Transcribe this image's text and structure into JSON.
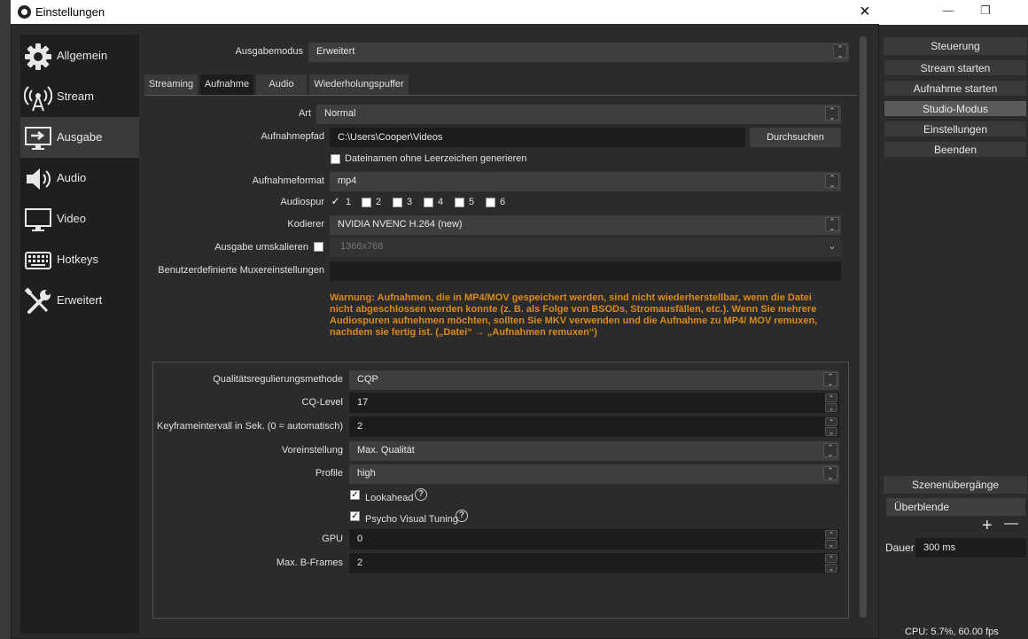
{
  "window": {
    "title": "Einstellungen",
    "close_icon": "×"
  },
  "sidebar": {
    "items": [
      {
        "label": "Allgemein",
        "icon": "gear-icon"
      },
      {
        "label": "Stream",
        "icon": "antenna-icon"
      },
      {
        "label": "Ausgabe",
        "icon": "monitor-arrow-icon",
        "active": true
      },
      {
        "label": "Audio",
        "icon": "speaker-icon"
      },
      {
        "label": "Video",
        "icon": "monitor-icon"
      },
      {
        "label": "Hotkeys",
        "icon": "keyboard-icon"
      },
      {
        "label": "Erweitert",
        "icon": "tools-icon"
      }
    ]
  },
  "output": {
    "mode_label": "Ausgabemodus",
    "mode_value": "Erweitert",
    "tabs": [
      "Streaming",
      "Aufnahme",
      "Audio",
      "Wiederholungspuffer"
    ],
    "active_tab": "Aufnahme"
  },
  "recording": {
    "type_label": "Art",
    "type_value": "Normal",
    "path_label": "Aufnahmepfad",
    "path_value": "C:\\Users\\Cooper\\Videos",
    "browse_label": "Durchsuchen",
    "nospace_label": "Dateinamen ohne Leerzeichen generieren",
    "format_label": "Aufnahmeformat",
    "format_value": "mp4",
    "tracks_label": "Audiospur",
    "tracks": [
      "1",
      "2",
      "3",
      "4",
      "5",
      "6"
    ],
    "encoder_label": "Kodierer",
    "encoder_value": "NVIDIA NVENC H.264 (new)",
    "rescale_label": "Ausgabe umskalieren",
    "rescale_value": "1366x768",
    "muxer_label": "Benutzerdefinierte Muxereinstellungen",
    "muxer_value": "",
    "warning": "Warnung: Aufnahmen, die in MP4/MOV gespeichert werden, sind nicht wiederherstellbar, wenn die Datei nicht abgeschlossen werden konnte (z. B. als Folge von BSODs, Stromausfällen, etc.). Wenn Sie mehrere Audiospuren aufnehmen möchten, sollten Sie MKV verwenden und die Aufnahme zu MP4/ MOV remuxen, nachdem sie fertig ist. („Datei“ → „Aufnahmen remuxen“)"
  },
  "encoder": {
    "rc_label": "Qualitätsregulierungsmethode",
    "rc_value": "CQP",
    "cq_label": "CQ-Level",
    "cq_value": "17",
    "keyint_label": "Keyframeintervall in Sek. (0 = automatisch)",
    "keyint_value": "2",
    "preset_label": "Voreinstellung",
    "preset_value": "Max. Qualität",
    "profile_label": "Profile",
    "profile_value": "high",
    "lookahead_label": "Lookahead",
    "psycho_label": "Psycho Visual Tuning",
    "gpu_label": "GPU",
    "gpu_value": "0",
    "bframes_label": "Max. B-Frames",
    "bframes_value": "2",
    "help_icon": "?"
  },
  "main_window": {
    "controls_title": "Steuerung",
    "buttons": [
      "Stream starten",
      "Aufnahme starten",
      "Studio-Modus",
      "Einstellungen",
      "Beenden"
    ],
    "transitions_title": "Szenenübergänge",
    "transition_value": "Überblende",
    "duration_label": "Dauer",
    "duration_value": "300 ms",
    "status": "CPU: 5.7%, 60.00 fps",
    "minimize": "—",
    "restore": "❐",
    "add": "+",
    "remove": "—"
  }
}
